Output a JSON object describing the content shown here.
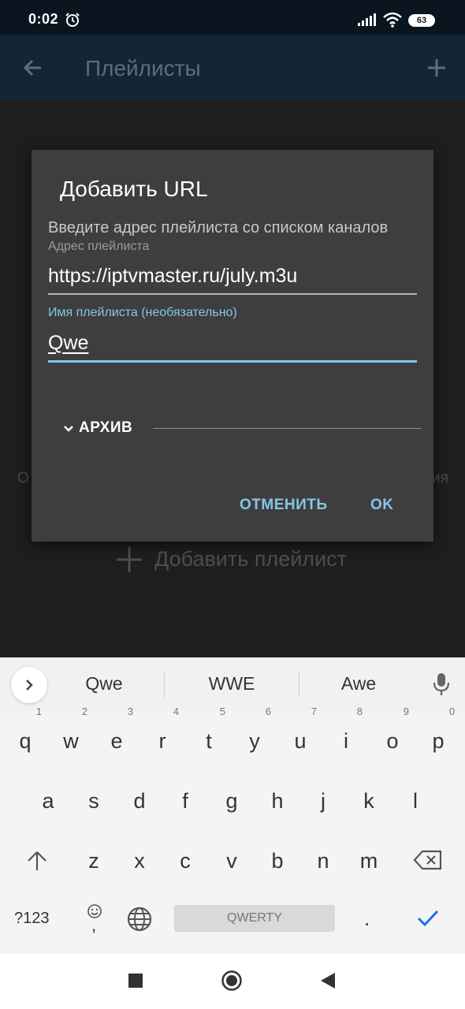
{
  "status_bar": {
    "time": "0:02",
    "battery": "63",
    "icons": [
      "alarm-icon",
      "signal-icon",
      "wifi-icon",
      "battery-icon"
    ]
  },
  "app_bar": {
    "title": "Плейлисты",
    "back_icon": "arrow-left-icon",
    "add_icon": "plus-icon"
  },
  "background": {
    "partial_text_left": "О",
    "partial_text_right": "ия",
    "add_playlist_label": "Добавить плейлист"
  },
  "dialog": {
    "title": "Добавить URL",
    "message": "Введите адрес плейлиста со списком каналов",
    "field_url": {
      "label": "Адрес плейлиста",
      "value": "https://iptvmaster.ru/july.m3u"
    },
    "field_name": {
      "label": "Имя плейлиста (необязательно)",
      "value": "Qwe"
    },
    "archive_label": "АРХИВ",
    "cancel_label": "ОТМЕНИТЬ",
    "ok_label": "OK"
  },
  "keyboard": {
    "suggestions": [
      "Qwe",
      "WWE",
      "Awe"
    ],
    "row1": [
      {
        "key": "q",
        "hint": "1"
      },
      {
        "key": "w",
        "hint": "2"
      },
      {
        "key": "e",
        "hint": "3"
      },
      {
        "key": "r",
        "hint": "4"
      },
      {
        "key": "t",
        "hint": "5"
      },
      {
        "key": "y",
        "hint": "6"
      },
      {
        "key": "u",
        "hint": "7"
      },
      {
        "key": "i",
        "hint": "8"
      },
      {
        "key": "o",
        "hint": "9"
      },
      {
        "key": "p",
        "hint": "0"
      }
    ],
    "row2": [
      "a",
      "s",
      "d",
      "f",
      "g",
      "h",
      "j",
      "k",
      "l"
    ],
    "row3": [
      "z",
      "x",
      "c",
      "v",
      "b",
      "n",
      "m"
    ],
    "symbols_label": "?123",
    "comma": ",",
    "space_label": "QWERTY",
    "period": ".",
    "accent_color": "#1a73e8"
  },
  "nav_bar": {
    "icons": [
      "recents-square-icon",
      "home-circle-icon",
      "back-triangle-icon"
    ]
  }
}
